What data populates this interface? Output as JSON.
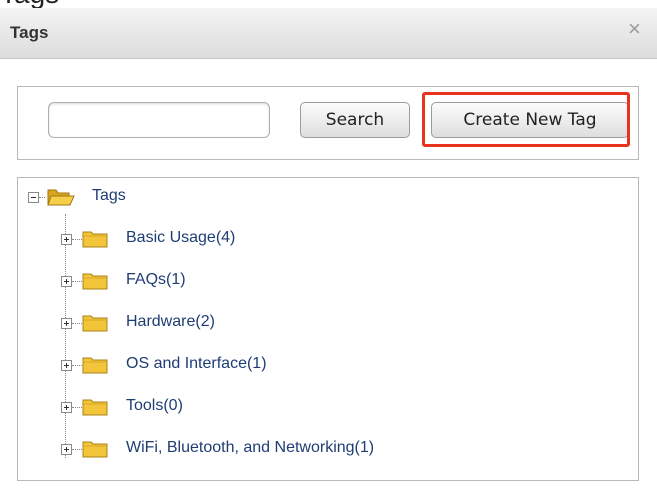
{
  "caption_partial": "Tags",
  "dialog": {
    "title": "Tags",
    "close_symbol": "×"
  },
  "search": {
    "value": "",
    "placeholder": "",
    "search_button_label": "Search",
    "create_button_label": "Create New Tag"
  },
  "tree": {
    "root_label": "Tags",
    "items": [
      {
        "label": "Basic Usage(4)"
      },
      {
        "label": "FAQs(1)"
      },
      {
        "label": "Hardware(2)"
      },
      {
        "label": "OS and Interface(1)"
      },
      {
        "label": "Tools(0)"
      },
      {
        "label": "WiFi, Bluetooth, and Networking(1)"
      }
    ]
  },
  "colors": {
    "highlight": "#e8331e",
    "link": "#1f3d74",
    "folder": "#f2c53a"
  },
  "icons": {
    "close": "close-icon",
    "root_folder": "folder-open-icon",
    "item_folder": "folder-icon",
    "expand": "plus-expander-icon",
    "collapse": "minus-expander-icon"
  }
}
